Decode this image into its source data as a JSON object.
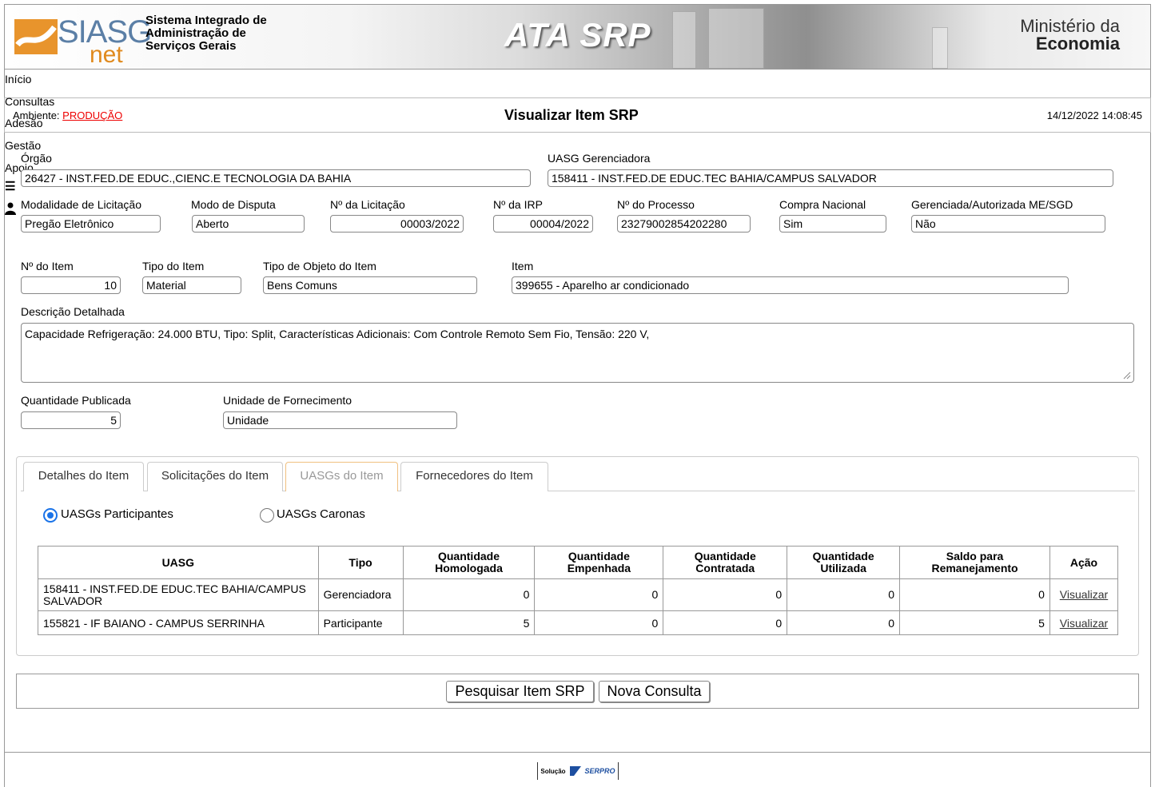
{
  "header": {
    "logo_siasg": "SIASG",
    "logo_net": "net",
    "system_name_line1": "Sistema Integrado de",
    "system_name_line2": "Administração de",
    "system_name_line3": "Serviços Gerais",
    "app_title": "ATA SRP",
    "ministry_line1": "Ministério da",
    "ministry_line2": "Economia"
  },
  "menu": {
    "items": [
      "Início",
      "Consultas",
      "Adesão",
      "Gestão",
      "Apoio"
    ],
    "icons": [
      "menu-icon",
      "user-icon"
    ]
  },
  "title_bar": {
    "env_label": "Ambiente:",
    "env_value": "PRODUÇÃO",
    "title": "Visualizar Item SRP",
    "datetime": "14/12/2022 14:08:45"
  },
  "form": {
    "orgao_label": "Órgão",
    "orgao_value": "26427 - INST.FED.DE EDUC.,CIENC.E TECNOLOGIA DA BAHIA",
    "uasg_ger_label": "UASG Gerenciadora",
    "uasg_ger_value": "158411 - INST.FED.DE EDUC.TEC BAHIA/CAMPUS SALVADOR",
    "modalidade_label": "Modalidade de Licitação",
    "modalidade_value": "Pregão Eletrônico",
    "modo_label": "Modo de Disputa",
    "modo_value": "Aberto",
    "licitacao_label": "Nº da Licitação",
    "licitacao_value": "00003/2022",
    "irp_label": "Nº da IRP",
    "irp_value": "00004/2022",
    "processo_label": "Nº do Processo",
    "processo_value": "23279002854202280",
    "compra_label": "Compra Nacional",
    "compra_value": "Sim",
    "gerenciada_label": "Gerenciada/Autorizada ME/SGD",
    "gerenciada_value": "Não",
    "num_item_label": "Nº do Item",
    "num_item_value": "10",
    "tipo_item_label": "Tipo do Item",
    "tipo_item_value": "Material",
    "tipo_objeto_label": "Tipo de Objeto do Item",
    "tipo_objeto_value": "Bens Comuns",
    "item_label": "Item",
    "item_value": "399655 - Aparelho ar condicionado",
    "descricao_label": "Descrição Detalhada",
    "descricao_value": "Capacidade Refrigeração: 24.000 BTU, Tipo: Split, Características Adicionais: Com Controle Remoto Sem Fio, Tensão: 220 V,",
    "qtd_label": "Quantidade Publicada",
    "qtd_value": "5",
    "unidade_label": "Unidade de Fornecimento",
    "unidade_value": "Unidade"
  },
  "tabs": [
    "Detalhes do Item",
    "Solicitações do Item",
    "UASGs do Item",
    "Fornecedores do Item"
  ],
  "active_tab": "UASGs do Item",
  "radios": {
    "participantes": "UASGs Participantes",
    "caronas": "UASGs Caronas",
    "selected": "UASGs Participantes"
  },
  "table": {
    "headers": [
      "UASG",
      "Tipo",
      "Quantidade Homologada",
      "Quantidade Empenhada",
      "Quantidade Contratada",
      "Quantidade Utilizada",
      "Saldo para Remanejamento",
      "Ação"
    ],
    "rows": [
      [
        "158411 - INST.FED.DE EDUC.TEC BAHIA/CAMPUS SALVADOR",
        "Gerenciadora",
        "0",
        "0",
        "0",
        "0",
        "0",
        "Visualizar"
      ],
      [
        "155821 - IF BAIANO - CAMPUS SERRINHA",
        "Participante",
        "5",
        "0",
        "0",
        "0",
        "5",
        "Visualizar"
      ]
    ]
  },
  "buttons": {
    "pesquisar": "Pesquisar Item SRP",
    "nova": "Nova Consulta"
  },
  "footer": {
    "solucao": "Solução",
    "serpro": "SERPRO"
  },
  "colors": {
    "env_value": "#e00000",
    "radio_selected": "#1a73e8",
    "active_tab_border": "#f0c080"
  }
}
